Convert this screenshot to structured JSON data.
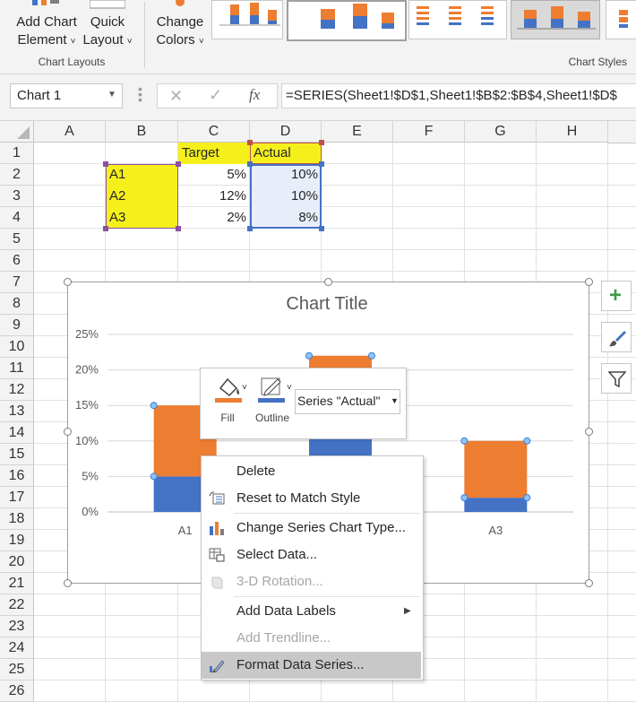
{
  "ribbon": {
    "add_chart_element_line1": "Add Chart",
    "add_chart_element_line2": "Element",
    "quick_layout_line1": "Quick",
    "quick_layout_line2": "Layout",
    "change_colors_line1": "Change",
    "change_colors_line2": "Colors",
    "group_chart_layouts": "Chart Layouts",
    "group_chart_styles": "Chart Styles"
  },
  "formula_bar": {
    "name_box": "Chart 1",
    "formula": "=SERIES(Sheet1!$D$1,Sheet1!$B$2:$B$4,Sheet1!$D$"
  },
  "columns": [
    "A",
    "B",
    "C",
    "D",
    "E",
    "F",
    "G",
    "H"
  ],
  "rows": [
    "1",
    "2",
    "3",
    "4",
    "5",
    "6",
    "7",
    "8",
    "9",
    "10",
    "11",
    "12",
    "13",
    "14",
    "15",
    "16",
    "17",
    "18",
    "19",
    "20",
    "21",
    "22",
    "23",
    "24",
    "25",
    "26"
  ],
  "cells": {
    "C1": "Target",
    "D1": "Actual",
    "B2": "A1",
    "C2": "5%",
    "D2": "10%",
    "B3": "A2",
    "C3": "12%",
    "D3": "10%",
    "B4": "A3",
    "C4": "2%",
    "D4": "8%"
  },
  "colors": {
    "target": "#4472c4",
    "actual": "#ed7d31",
    "highlight_yellow": "#f5f01c",
    "actual_range_fill": "#e8eef9"
  },
  "chart_data": {
    "type": "bar",
    "stacked": true,
    "title": "Chart Title",
    "categories": [
      "A1",
      "A2",
      "A3"
    ],
    "series": [
      {
        "name": "Target",
        "values": [
          5,
          12,
          2
        ],
        "color": "#4472c4"
      },
      {
        "name": "Actual",
        "values": [
          10,
          10,
          8
        ],
        "color": "#ed7d31"
      }
    ],
    "yticks": [
      "0%",
      "5%",
      "10%",
      "15%",
      "20%",
      "25%"
    ],
    "ylim": [
      0,
      25
    ],
    "grid": true
  },
  "mini_toolbar": {
    "fill_label": "Fill",
    "outline_label": "Outline",
    "series_select": "Series \"Actual\""
  },
  "context_menu": [
    {
      "label": "Delete",
      "disabled": false,
      "icon": ""
    },
    {
      "label": "Reset to Match Style",
      "disabled": false,
      "icon": "reset-style-icon"
    },
    {
      "label": "Change Series Chart Type...",
      "disabled": false,
      "icon": "change-chart-type-icon"
    },
    {
      "label": "Select Data...",
      "disabled": false,
      "icon": "select-data-icon"
    },
    {
      "label": "3-D Rotation...",
      "disabled": true,
      "icon": "3d-rotation-icon"
    },
    {
      "label": "Add Data Labels",
      "disabled": false,
      "icon": "",
      "submenu": true
    },
    {
      "label": "Add Trendline...",
      "disabled": true,
      "icon": ""
    },
    {
      "label": "Format Data Series...",
      "disabled": false,
      "icon": "format-series-icon",
      "highlighted": true
    }
  ]
}
